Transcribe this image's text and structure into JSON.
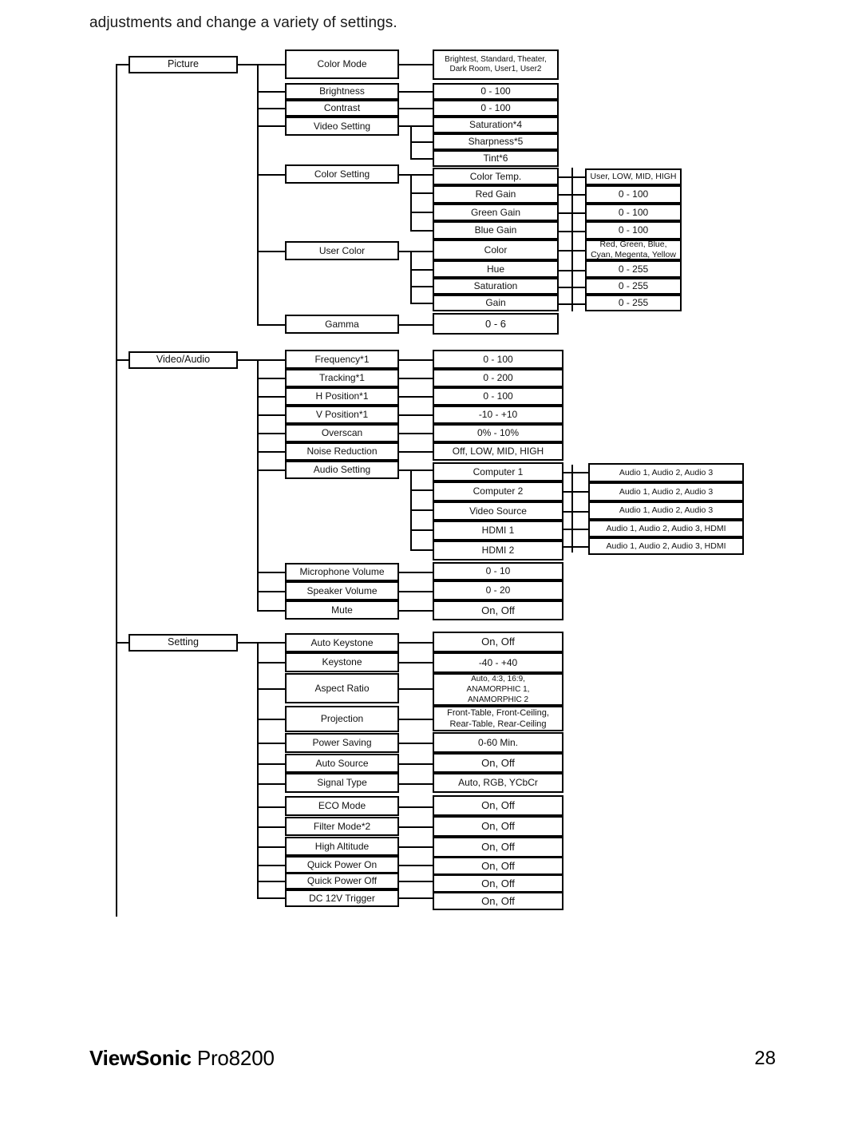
{
  "document": {
    "intro_text": "adjustments and change a variety of settings.",
    "footer_brand": "ViewSonic",
    "footer_model": "Pro8200",
    "page_number": "28"
  },
  "menu_tree": {
    "level1": [
      {
        "label": "Picture"
      },
      {
        "label": "Video/Audio"
      },
      {
        "label": "Setting"
      }
    ],
    "picture": {
      "items": [
        {
          "label": "Color Mode"
        },
        {
          "label": "Brightness"
        },
        {
          "label": "Contrast"
        },
        {
          "label": "Video Setting"
        },
        {
          "label": "Color Setting"
        },
        {
          "label": "User Color"
        },
        {
          "label": "Gamma"
        }
      ],
      "values": [
        {
          "label": "Brightest, Standard, Theater,\nDark Room, User1, User2"
        },
        {
          "label": "0 - 100"
        },
        {
          "label": "0 - 100"
        },
        {
          "label": "Saturation*4"
        },
        {
          "label": "Sharpness*5"
        },
        {
          "label": "Tint*6"
        },
        {
          "label": "Color Temp."
        },
        {
          "label": "Red Gain"
        },
        {
          "label": "Green Gain"
        },
        {
          "label": "Blue Gain"
        },
        {
          "label": "Color"
        },
        {
          "label": "Hue"
        },
        {
          "label": "Saturation"
        },
        {
          "label": "Gain"
        },
        {
          "label": "0 - 6"
        }
      ],
      "subvalues": [
        {
          "label": "User, LOW, MID, HIGH"
        },
        {
          "label": "0 - 100"
        },
        {
          "label": "0 - 100"
        },
        {
          "label": "0 - 100"
        },
        {
          "label": "Red, Green, Blue,\nCyan, Megenta, Yellow"
        },
        {
          "label": "0 - 255"
        },
        {
          "label": "0 - 255"
        },
        {
          "label": "0 - 255"
        }
      ]
    },
    "video_audio": {
      "items": [
        {
          "label": "Frequency*1"
        },
        {
          "label": "Tracking*1"
        },
        {
          "label": "H Position*1"
        },
        {
          "label": "V Position*1"
        },
        {
          "label": "Overscan"
        },
        {
          "label": "Noise Reduction"
        },
        {
          "label": "Audio Setting"
        },
        {
          "label": "Microphone Volume"
        },
        {
          "label": "Speaker Volume"
        },
        {
          "label": "Mute"
        }
      ],
      "values": [
        {
          "label": "0 - 100"
        },
        {
          "label": "0 - 200"
        },
        {
          "label": "0 - 100"
        },
        {
          "label": "-10 - +10"
        },
        {
          "label": "0% - 10%"
        },
        {
          "label": "Off, LOW, MID, HIGH"
        },
        {
          "label": "Computer 1"
        },
        {
          "label": "Computer 2"
        },
        {
          "label": "Video Source"
        },
        {
          "label": "HDMI 1"
        },
        {
          "label": "HDMI 2"
        },
        {
          "label": "0 - 10"
        },
        {
          "label": "0 - 20"
        },
        {
          "label": "On, Off"
        }
      ],
      "subvalues": [
        {
          "label": "Audio 1, Audio 2, Audio 3"
        },
        {
          "label": "Audio 1, Audio 2, Audio 3"
        },
        {
          "label": "Audio 1, Audio 2, Audio 3"
        },
        {
          "label": "Audio 1, Audio 2, Audio 3, HDMI"
        },
        {
          "label": "Audio 1, Audio 2, Audio 3, HDMI"
        }
      ]
    },
    "setting": {
      "items": [
        {
          "label": "Auto Keystone"
        },
        {
          "label": "Keystone"
        },
        {
          "label": "Aspect Ratio"
        },
        {
          "label": "Projection"
        },
        {
          "label": "Power Saving"
        },
        {
          "label": "Auto Source"
        },
        {
          "label": "Signal Type"
        },
        {
          "label": "ECO Mode"
        },
        {
          "label": "Filter Mode*2"
        },
        {
          "label": "High Altitude"
        },
        {
          "label": "Quick Power On"
        },
        {
          "label": "Quick Power Off"
        },
        {
          "label": "DC 12V Trigger"
        }
      ],
      "values": [
        {
          "label": "On, Off"
        },
        {
          "label": "-40 - +40"
        },
        {
          "label": "Auto, 4:3, 16:9,\nANAMORPHIC 1,\nANAMORPHIC 2"
        },
        {
          "label": "Front-Table, Front-Ceiling,\nRear-Table, Rear-Ceiling"
        },
        {
          "label": "0-60 Min."
        },
        {
          "label": "On, Off"
        },
        {
          "label": "Auto, RGB, YCbCr"
        },
        {
          "label": "On, Off"
        },
        {
          "label": "On, Off"
        },
        {
          "label": "On, Off"
        },
        {
          "label": "On, Off"
        },
        {
          "label": "On, Off"
        },
        {
          "label": "On, Off"
        }
      ]
    }
  }
}
